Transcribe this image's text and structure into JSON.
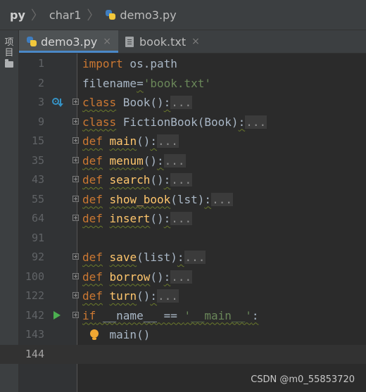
{
  "breadcrumb": {
    "root": "py",
    "folder": "char1",
    "file": "demo3.py"
  },
  "sidebar": {
    "project_tab": "项目"
  },
  "tabs": [
    {
      "label": "demo3.py",
      "close": "×"
    },
    {
      "label": "book.txt",
      "close": "×"
    }
  ],
  "code": [
    {
      "line": "1",
      "tokens": [
        [
          "kw",
          "import"
        ],
        [
          "dim",
          " os.path"
        ]
      ]
    },
    {
      "line": "2",
      "tokens": [
        [
          "dim",
          "filename"
        ],
        [
          "dimw",
          "="
        ],
        [
          "str",
          "'book.txt'"
        ]
      ]
    },
    {
      "line": "3",
      "tokens": [
        [
          "kww",
          "class"
        ],
        [
          "dim",
          " Book()"
        ],
        [
          "dimw",
          ":"
        ],
        [
          "fold",
          "..."
        ]
      ]
    },
    {
      "line": "9",
      "tokens": [
        [
          "kww",
          "class"
        ],
        [
          "dim",
          " FictionBook(Book)"
        ],
        [
          "dimw",
          ":"
        ],
        [
          "fold",
          "..."
        ]
      ]
    },
    {
      "line": "15",
      "tokens": [
        [
          "kww",
          "def"
        ],
        [
          "dim",
          " "
        ],
        [
          "fnw",
          "main"
        ],
        [
          "dim",
          "()"
        ],
        [
          "dimw",
          ":"
        ],
        [
          "fold",
          "..."
        ]
      ]
    },
    {
      "line": "35",
      "tokens": [
        [
          "kww",
          "def"
        ],
        [
          "dim",
          " "
        ],
        [
          "fnw",
          "menum"
        ],
        [
          "dim",
          "()"
        ],
        [
          "dimw",
          ":"
        ],
        [
          "fold",
          "..."
        ]
      ]
    },
    {
      "line": "43",
      "tokens": [
        [
          "kww",
          "def"
        ],
        [
          "dim",
          " "
        ],
        [
          "fnw",
          "search"
        ],
        [
          "dim",
          "()"
        ],
        [
          "dimw",
          ":"
        ],
        [
          "fold",
          "..."
        ]
      ]
    },
    {
      "line": "55",
      "tokens": [
        [
          "kww",
          "def"
        ],
        [
          "dim",
          " "
        ],
        [
          "fnw",
          "show_book"
        ],
        [
          "dim",
          "(lst)"
        ],
        [
          "dimw",
          ":"
        ],
        [
          "fold",
          "..."
        ]
      ]
    },
    {
      "line": "64",
      "tokens": [
        [
          "kww",
          "def"
        ],
        [
          "dim",
          " "
        ],
        [
          "fnw",
          "insert"
        ],
        [
          "dim",
          "()"
        ],
        [
          "dimw",
          ":"
        ],
        [
          "fold",
          "..."
        ]
      ]
    },
    {
      "line": "91",
      "tokens": []
    },
    {
      "line": "92",
      "tokens": [
        [
          "kww",
          "def"
        ],
        [
          "dim",
          " "
        ],
        [
          "fnw",
          "save"
        ],
        [
          "dim",
          "(list)"
        ],
        [
          "dimw",
          ":"
        ],
        [
          "fold",
          "..."
        ]
      ]
    },
    {
      "line": "100",
      "tokens": [
        [
          "kww",
          "def"
        ],
        [
          "dim",
          " "
        ],
        [
          "fnw",
          "borrow"
        ],
        [
          "dim",
          "()"
        ],
        [
          "dimw",
          ":"
        ],
        [
          "fold",
          "..."
        ]
      ]
    },
    {
      "line": "122",
      "tokens": [
        [
          "kww",
          "def"
        ],
        [
          "dim",
          " "
        ],
        [
          "fnw",
          "turn"
        ],
        [
          "dim",
          "()"
        ],
        [
          "dimw",
          ":"
        ],
        [
          "fold",
          "..."
        ]
      ]
    },
    {
      "line": "142",
      "tokens": [
        [
          "kww",
          "if"
        ],
        [
          "dimw",
          " __name__ == "
        ],
        [
          "strw",
          "'__main__'"
        ],
        [
          "dimw",
          ":"
        ]
      ]
    },
    {
      "line": "143",
      "tokens": [
        [
          "dim",
          "    main()"
        ]
      ]
    },
    {
      "line": "144",
      "tokens": []
    }
  ],
  "watermark": "CSDN @m0_55853720"
}
